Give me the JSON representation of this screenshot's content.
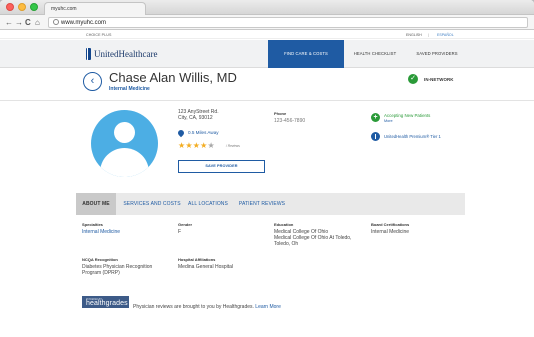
{
  "browser": {
    "tab_title": "myuhc.com",
    "url": "www.myuhc.com",
    "icons": [
      "close-icon",
      "minimize-icon",
      "zoom-icon",
      "back-arrow-icon",
      "forward-arrow-icon",
      "reload-icon",
      "home-icon",
      "globe-icon"
    ]
  },
  "site": {
    "choice_plus": "CHOICE PLUS",
    "lang_en": "ENGLISH",
    "lang_sep": "|",
    "lang_es": "ESPAÑOL",
    "logo": "UnitedHealthcare",
    "nav": [
      {
        "label": "FIND CARE & COSTS"
      },
      {
        "label": "HEALTH CHECKLIST"
      },
      {
        "label": "SAVED PROVIDERS"
      }
    ]
  },
  "doctor": {
    "name": "Chase Alan Willis, MD",
    "specialty": "Internal Medicine",
    "network_status": "IN-NETWORK",
    "address_line1": "123 AnyStreet Rd.",
    "address_line2": "City, CA, 93012",
    "distance": "0.5 Miles Away",
    "rating": 4,
    "rating_max": 5,
    "reviews": "/ Reviews",
    "save_label": "SAVE PROVIDER",
    "phone_label": "Phone",
    "phone": "123-456-7890",
    "accepting": "Accepting New Patients",
    "more": "More",
    "tier": "UnitedHealth Premium® Tier 1"
  },
  "profile_tabs": [
    {
      "label": "ABOUT ME"
    },
    {
      "label": "SERVICES AND COSTS"
    },
    {
      "label": "ALL LOCATIONS"
    },
    {
      "label": "PATIENT REVIEWS"
    }
  ],
  "about": {
    "specialties_label": "Specialties",
    "specialties_value": "Internal Medicine",
    "gender_label": "Gender",
    "gender_value": "F",
    "education_label": "Education",
    "education_value_1": "Medical College Of Ohio",
    "education_value_2": "Medical College Of Ohio At Toledo, Toledo, Oh",
    "board_label": "Board Certifications",
    "board_value": "Internal Medicine",
    "ncqa_label": "NCQA Recognition",
    "ncqa_value": "Diabetes Physician Recognition Program (DPRP)",
    "hospital_label": "Hospital Affiliations",
    "hospital_value": "Medina General Hospital"
  },
  "footer": {
    "powered_by": "POWERED BY",
    "healthgrades": "healthgrades",
    "note": "Physician reviews are brought to you by Healthgrades.",
    "learn_more": "Learn More"
  }
}
